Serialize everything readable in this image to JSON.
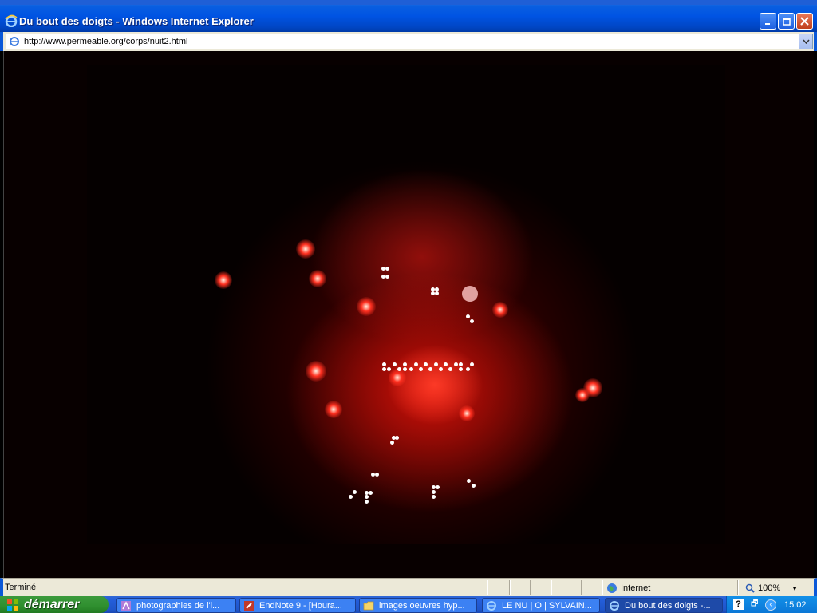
{
  "window": {
    "title": "Du bout des doigts - Windows Internet Explorer"
  },
  "address": {
    "url": "http://www.permeable.org/corps/nuit2.html"
  },
  "status": {
    "text": "Terminé",
    "zone": "Internet",
    "zoom": "100%"
  },
  "taskbar": {
    "start_label": "démarrer",
    "tasks": [
      {
        "label": "photographies de l'i..."
      },
      {
        "label": "EndNote 9 - [Houra..."
      },
      {
        "label": "images oeuvres hyp..."
      },
      {
        "label": "LE NU | O | SYLVAIN..."
      },
      {
        "label": "Du bout des doigts -..."
      }
    ],
    "clock": "15:02"
  },
  "colors": {
    "title_bar": "#0054e3",
    "chrome": "#ece9d8",
    "start_button": "#2f8f2f",
    "led_red": "#ff3020"
  }
}
